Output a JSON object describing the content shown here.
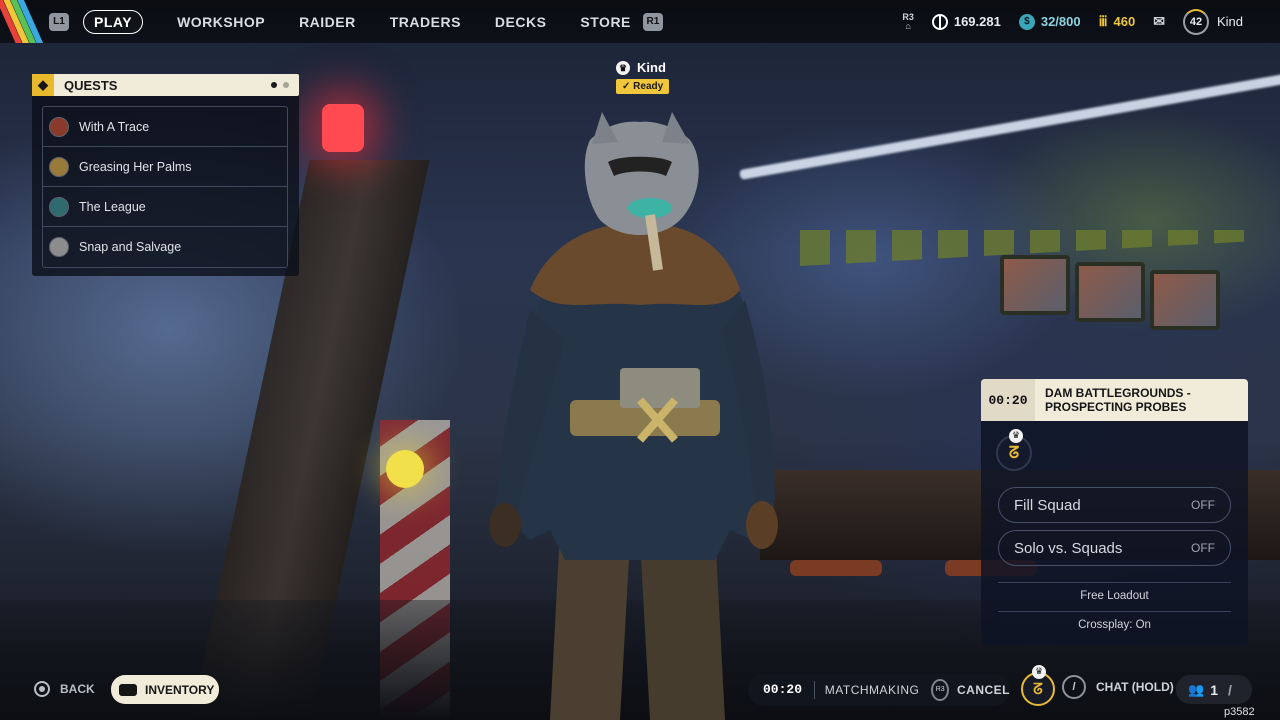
{
  "nav": {
    "left_bumper": "L1",
    "right_bumper": "R1",
    "tabs": [
      "PLAY",
      "WORKSHOP",
      "RAIDER",
      "TRADERS",
      "DECKS",
      "STORE"
    ]
  },
  "stats": {
    "r3_label": "R3",
    "currency": "169.281",
    "credits": "32/800",
    "tokens": "460",
    "level": "42",
    "player_name": "Kind"
  },
  "quests": {
    "title": "QUESTS",
    "items": [
      "With A Trace",
      "Greasing Her Palms",
      "The League",
      "Snap and Salvage"
    ]
  },
  "player_tag": {
    "name": "Kind",
    "status": "Ready"
  },
  "match": {
    "timer": "00:20",
    "map_line1": "DAM BATTLEGROUNDS -",
    "map_line2": "PROSPECTING PROBES",
    "fill_squad_label": "Fill Squad",
    "fill_squad_value": "OFF",
    "solo_label": "Solo vs. Squads",
    "solo_value": "OFF",
    "loadout": "Free Loadout",
    "crossplay": "Crossplay: On"
  },
  "bottom": {
    "back": "BACK",
    "inventory": "INVENTORY",
    "timer": "00:20",
    "matchmaking": "MATCHMAKING",
    "r3_label": "R3",
    "cancel": "CANCEL",
    "chat": "CHAT (HOLD)",
    "party_count": "1",
    "build": "p3582"
  },
  "colors": {
    "accent_yellow": "#e8ba34",
    "panel_cream": "#f1ecd9",
    "credits_teal": "#3aa7b9"
  }
}
